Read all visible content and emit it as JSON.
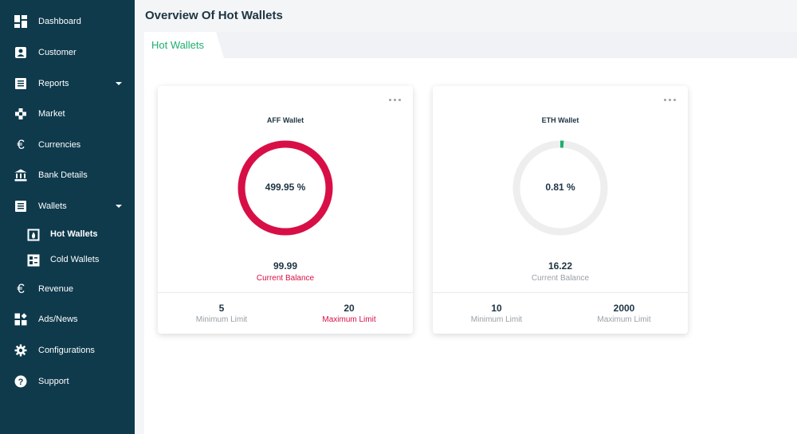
{
  "sidebar": {
    "items": [
      {
        "label": "Dashboard",
        "icon": "dashboard-icon"
      },
      {
        "label": "Customer",
        "icon": "customer-icon"
      },
      {
        "label": "Reports",
        "icon": "reports-icon"
      },
      {
        "label": "Market",
        "icon": "market-icon"
      },
      {
        "label": "Currencies",
        "icon": "euro-icon"
      },
      {
        "label": "Bank Details",
        "icon": "bank-icon"
      },
      {
        "label": "Wallets",
        "icon": "wallets-icon"
      },
      {
        "label": "Revenue",
        "icon": "euro-icon"
      },
      {
        "label": "Ads/News",
        "icon": "ads-icon"
      },
      {
        "label": "Configurations",
        "icon": "gear-icon"
      },
      {
        "label": "Support",
        "icon": "help-icon"
      }
    ],
    "wallets_sub": [
      {
        "label": "Hot Wallets",
        "icon": "hot-wallet-icon",
        "active": true
      },
      {
        "label": "Cold Wallets",
        "icon": "cold-wallet-icon",
        "active": false
      }
    ]
  },
  "page": {
    "title": "Overview Of Hot Wallets",
    "tab": "Hot Wallets"
  },
  "colors": {
    "sidebar_bg": "#0e3a4c",
    "accent_green": "#1fae6e",
    "danger_red": "#d80f46",
    "track_gray": "#eeeeee"
  },
  "wallets": [
    {
      "title": "AFF Wallet",
      "percent_label": "499.95 %",
      "percent": 499.95,
      "ring_color": "#d80f46",
      "balance": "99.99",
      "balance_label": "Current Balance",
      "min_value": "5",
      "min_label": "Minimum Limit",
      "max_value": "20",
      "max_label": "Maximum Limit"
    },
    {
      "title": "ETH Wallet",
      "percent_label": "0.81 %",
      "percent": 0.81,
      "ring_color": "#1fae6e",
      "balance": "16.22",
      "balance_label": "Current Balance",
      "min_value": "10",
      "min_label": "Minimum Limit",
      "max_value": "2000",
      "max_label": "Maximum Limit"
    }
  ]
}
